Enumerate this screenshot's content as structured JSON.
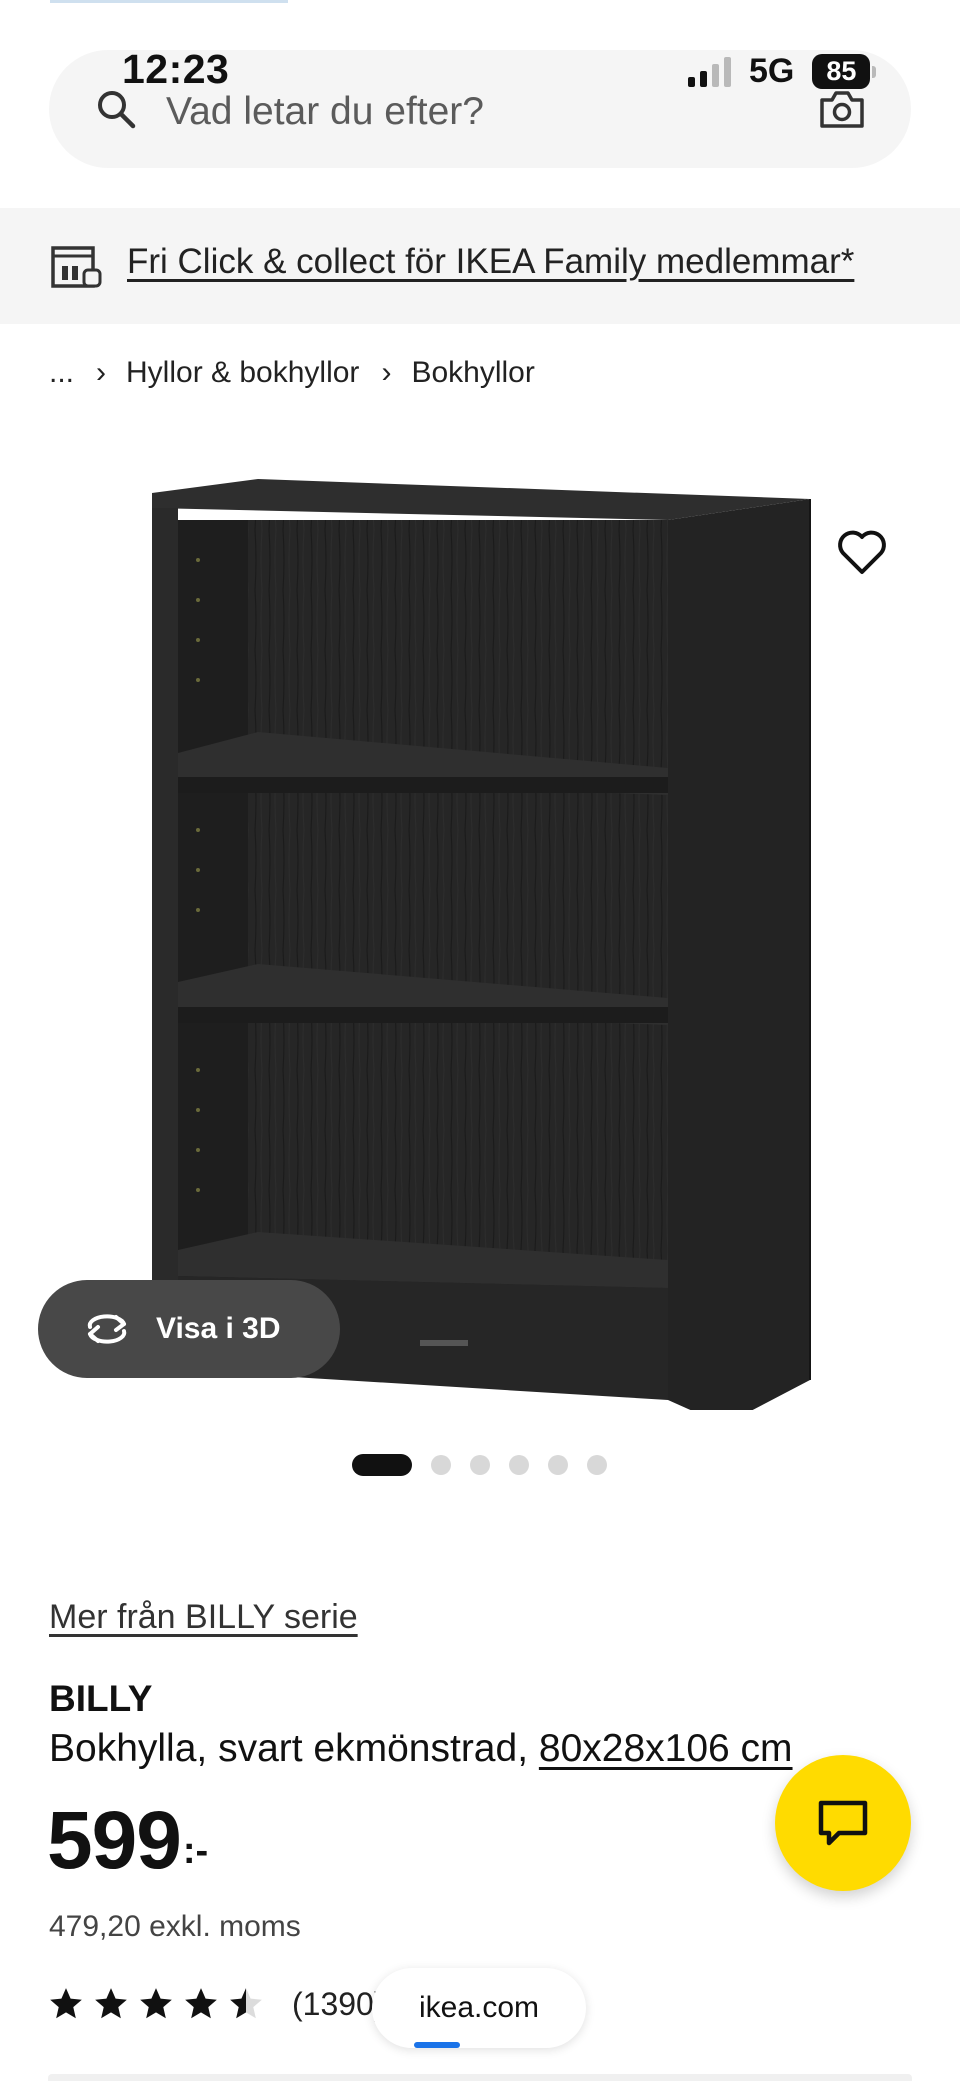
{
  "status_bar": {
    "time": "12:23",
    "network": "5G",
    "battery": "85"
  },
  "search": {
    "placeholder": "Vad letar du efter?",
    "icon": "search-icon",
    "camera_icon": "camera-icon"
  },
  "promo": {
    "text": "Fri Click & collect för IKEA Family medlemmar*",
    "icon": "store-pickup-icon"
  },
  "breadcrumb": {
    "items": [
      "...",
      "Hyllor & bokhyllor",
      "Bokhyllor"
    ]
  },
  "gallery": {
    "view_3d_label": "Visa i 3D",
    "image_count": 6,
    "active_index": 0
  },
  "product": {
    "series_link": "Mer från BILLY serie",
    "name": "BILLY",
    "description": "Bokhylla, svart ekmönstrad, ",
    "dimensions": "80x28x106 cm",
    "price": "599",
    "price_suffix": ":-",
    "price_excl": "479,20 exkl. moms",
    "rating": 4.5,
    "rating_count": "(1390)"
  },
  "browser": {
    "url": "ikea.com"
  },
  "colors": {
    "chat_button": "#ffdb00",
    "page_bg": "#ffffff",
    "banner_bg": "#f5f5f5",
    "progress": "#1a73e8"
  }
}
